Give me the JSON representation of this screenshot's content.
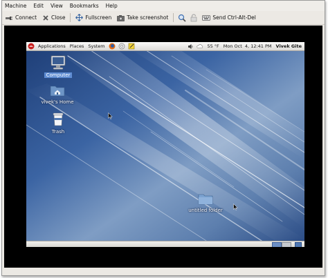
{
  "menubar": {
    "items": [
      "Machine",
      "Edit",
      "View",
      "Bookmarks",
      "Help"
    ]
  },
  "toolbar": {
    "connect_label": "Connect",
    "close_label": "Close",
    "fullscreen_label": "Fullscreen",
    "screenshot_label": "Take screenshot",
    "send_keys_label": "Send Ctrl-Alt-Del"
  },
  "guest": {
    "panel": {
      "applications": "Applications",
      "places": "Places",
      "system": "System",
      "weather": "55 °F",
      "clock": "Mon Oct  4, 12:41 PM",
      "user": "Vivek Gite"
    },
    "desktop_icons": {
      "computer": "Computer",
      "home": "vivek's Home",
      "trash": "Trash",
      "folder": "untitled folder"
    }
  },
  "colors": {
    "desktop_blue": "#2d4f86",
    "selection_blue": "#5f8dd3",
    "viewer_background": "#000000"
  }
}
